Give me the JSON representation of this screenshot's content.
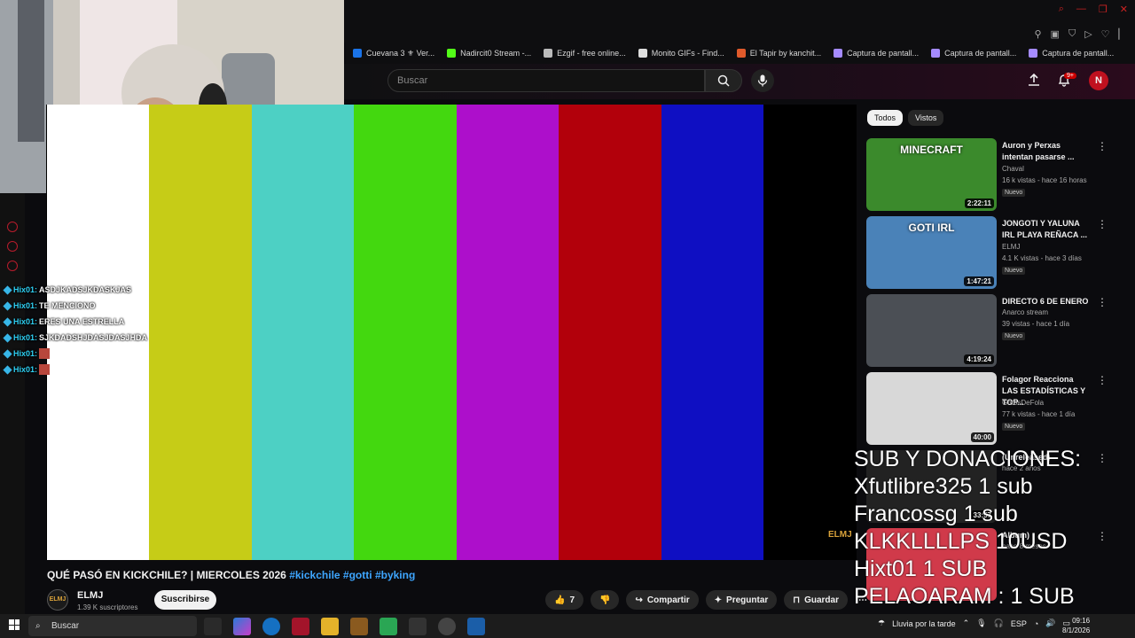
{
  "bookmarks": [
    {
      "label": "Cuevana 3 ⚜ Ver...",
      "color": "#1a73e8"
    },
    {
      "label": "Nadircit0 Stream -...",
      "color": "#53fc18"
    },
    {
      "label": "Ezgif - free online...",
      "color": "#bbbbbb"
    },
    {
      "label": "Monito GIFs - Find...",
      "color": "#dddddd"
    },
    {
      "label": "El Tapir by kanchit...",
      "color": "#e05a2b"
    },
    {
      "label": "Captura de pantall...",
      "color": "#a58bff"
    },
    {
      "label": "Captura de pantall...",
      "color": "#a58bff"
    },
    {
      "label": "Captura de pantall...",
      "color": "#a58bff"
    }
  ],
  "search": {
    "placeholder": "Buscar"
  },
  "notifications": {
    "count": "9+"
  },
  "account": {
    "initial": "N"
  },
  "colors": {
    "accent": "#3ea6ff",
    "brand_red": "#cc0000",
    "chat_user": "#2ecff2"
  },
  "player": {
    "color_bars": [
      "#ffffff",
      "#c6cc17",
      "#4dd0c4",
      "#43d80f",
      "#ad0fcb",
      "#b2000b",
      "#0f0fc2",
      "#000000"
    ],
    "watermark": "ELMJ"
  },
  "chat": [
    {
      "user": "Hix01:",
      "message": "ASDJKADSJKDASKJAS",
      "emote": false
    },
    {
      "user": "Hix01:",
      "message": "TE MENCIONO",
      "emote": false
    },
    {
      "user": "Hix01:",
      "message": "ERES UNA ESTRELLA",
      "emote": false
    },
    {
      "user": "Hix01:",
      "message": "SJKDADSHJDASJDASJHDA",
      "emote": false
    },
    {
      "user": "Hix01:",
      "message": "",
      "emote": true
    },
    {
      "user": "Hix01:",
      "message": "",
      "emote": true
    }
  ],
  "video": {
    "title": "QUÉ PASÓ EN KICKCHILE? | MIERCOLES 2026",
    "tags": [
      "#kickchile",
      "#gotti",
      "#byking"
    ],
    "channel": "ELMJ",
    "subscribers": "1.39 K suscriptores",
    "subscribe_label": "Suscribirse",
    "likes": "7",
    "share_label": "Compartir",
    "ask_label": "Preguntar",
    "save_label": "Guardar"
  },
  "chips": [
    "Todos",
    "Vistos"
  ],
  "recommendations": [
    {
      "title": "Auron y Perxas intentan pasarse ...",
      "channel": "Chaval",
      "meta": "16 k vistas - hace 16 horas",
      "badge": "Nuevo",
      "duration": "2:22:11",
      "thumb_bg": "#3b8a2c",
      "thumb_text": "MINECRAFT"
    },
    {
      "title": "JONGOTI Y YALUNA IRL PLAYA REÑACA ...",
      "channel": "ELMJ",
      "meta": "4.1 K vistas - hace 3 días",
      "badge": "Nuevo",
      "duration": "1:47:21",
      "thumb_bg": "#4a82b8",
      "thumb_text": "GOTI IRL"
    },
    {
      "title": "DIRECTO 6 DE ENERO",
      "channel": "Anarco stream",
      "meta": "39 vistas - hace 1 día",
      "badge": "Nuevo",
      "duration": "4:19:24",
      "thumb_bg": "#4b4f55",
      "thumb_text": ""
    },
    {
      "title": "Folagor Reacciona LAS ESTADÍSTICAS Y TOP...",
      "channel": "GritosDeFola",
      "meta": "77 k vistas - hace 1 día",
      "badge": "Nuevo",
      "duration": "40:00",
      "thumb_bg": "#d8d8d8",
      "thumb_text": ""
    },
    {
      "title": "(Unreleased)",
      "channel": "",
      "meta": "hace 2 años",
      "badge": "",
      "duration": "33:57",
      "thumb_bg": "#222222",
      "thumb_text": ""
    },
    {
      "title": "Album)",
      "channel": "",
      "meta": "hace 8 meses",
      "badge": "",
      "duration": "",
      "thumb_bg": "#d03a4a",
      "thumb_text": ""
    }
  ],
  "donations": [
    "SUB Y DONACIONES:",
    "Xfutlibre325 1 sub",
    "Francossg 1 sub",
    "KLKKLLLLPS 10USD",
    "Hixt01 1 SUB",
    "PELAOARAM : 1 SUB"
  ],
  "taskbar": {
    "search_label": "Buscar",
    "weather": "Lluvia por la tarde",
    "language": "ESP",
    "time": "09:16",
    "date": "8/1/2026"
  }
}
